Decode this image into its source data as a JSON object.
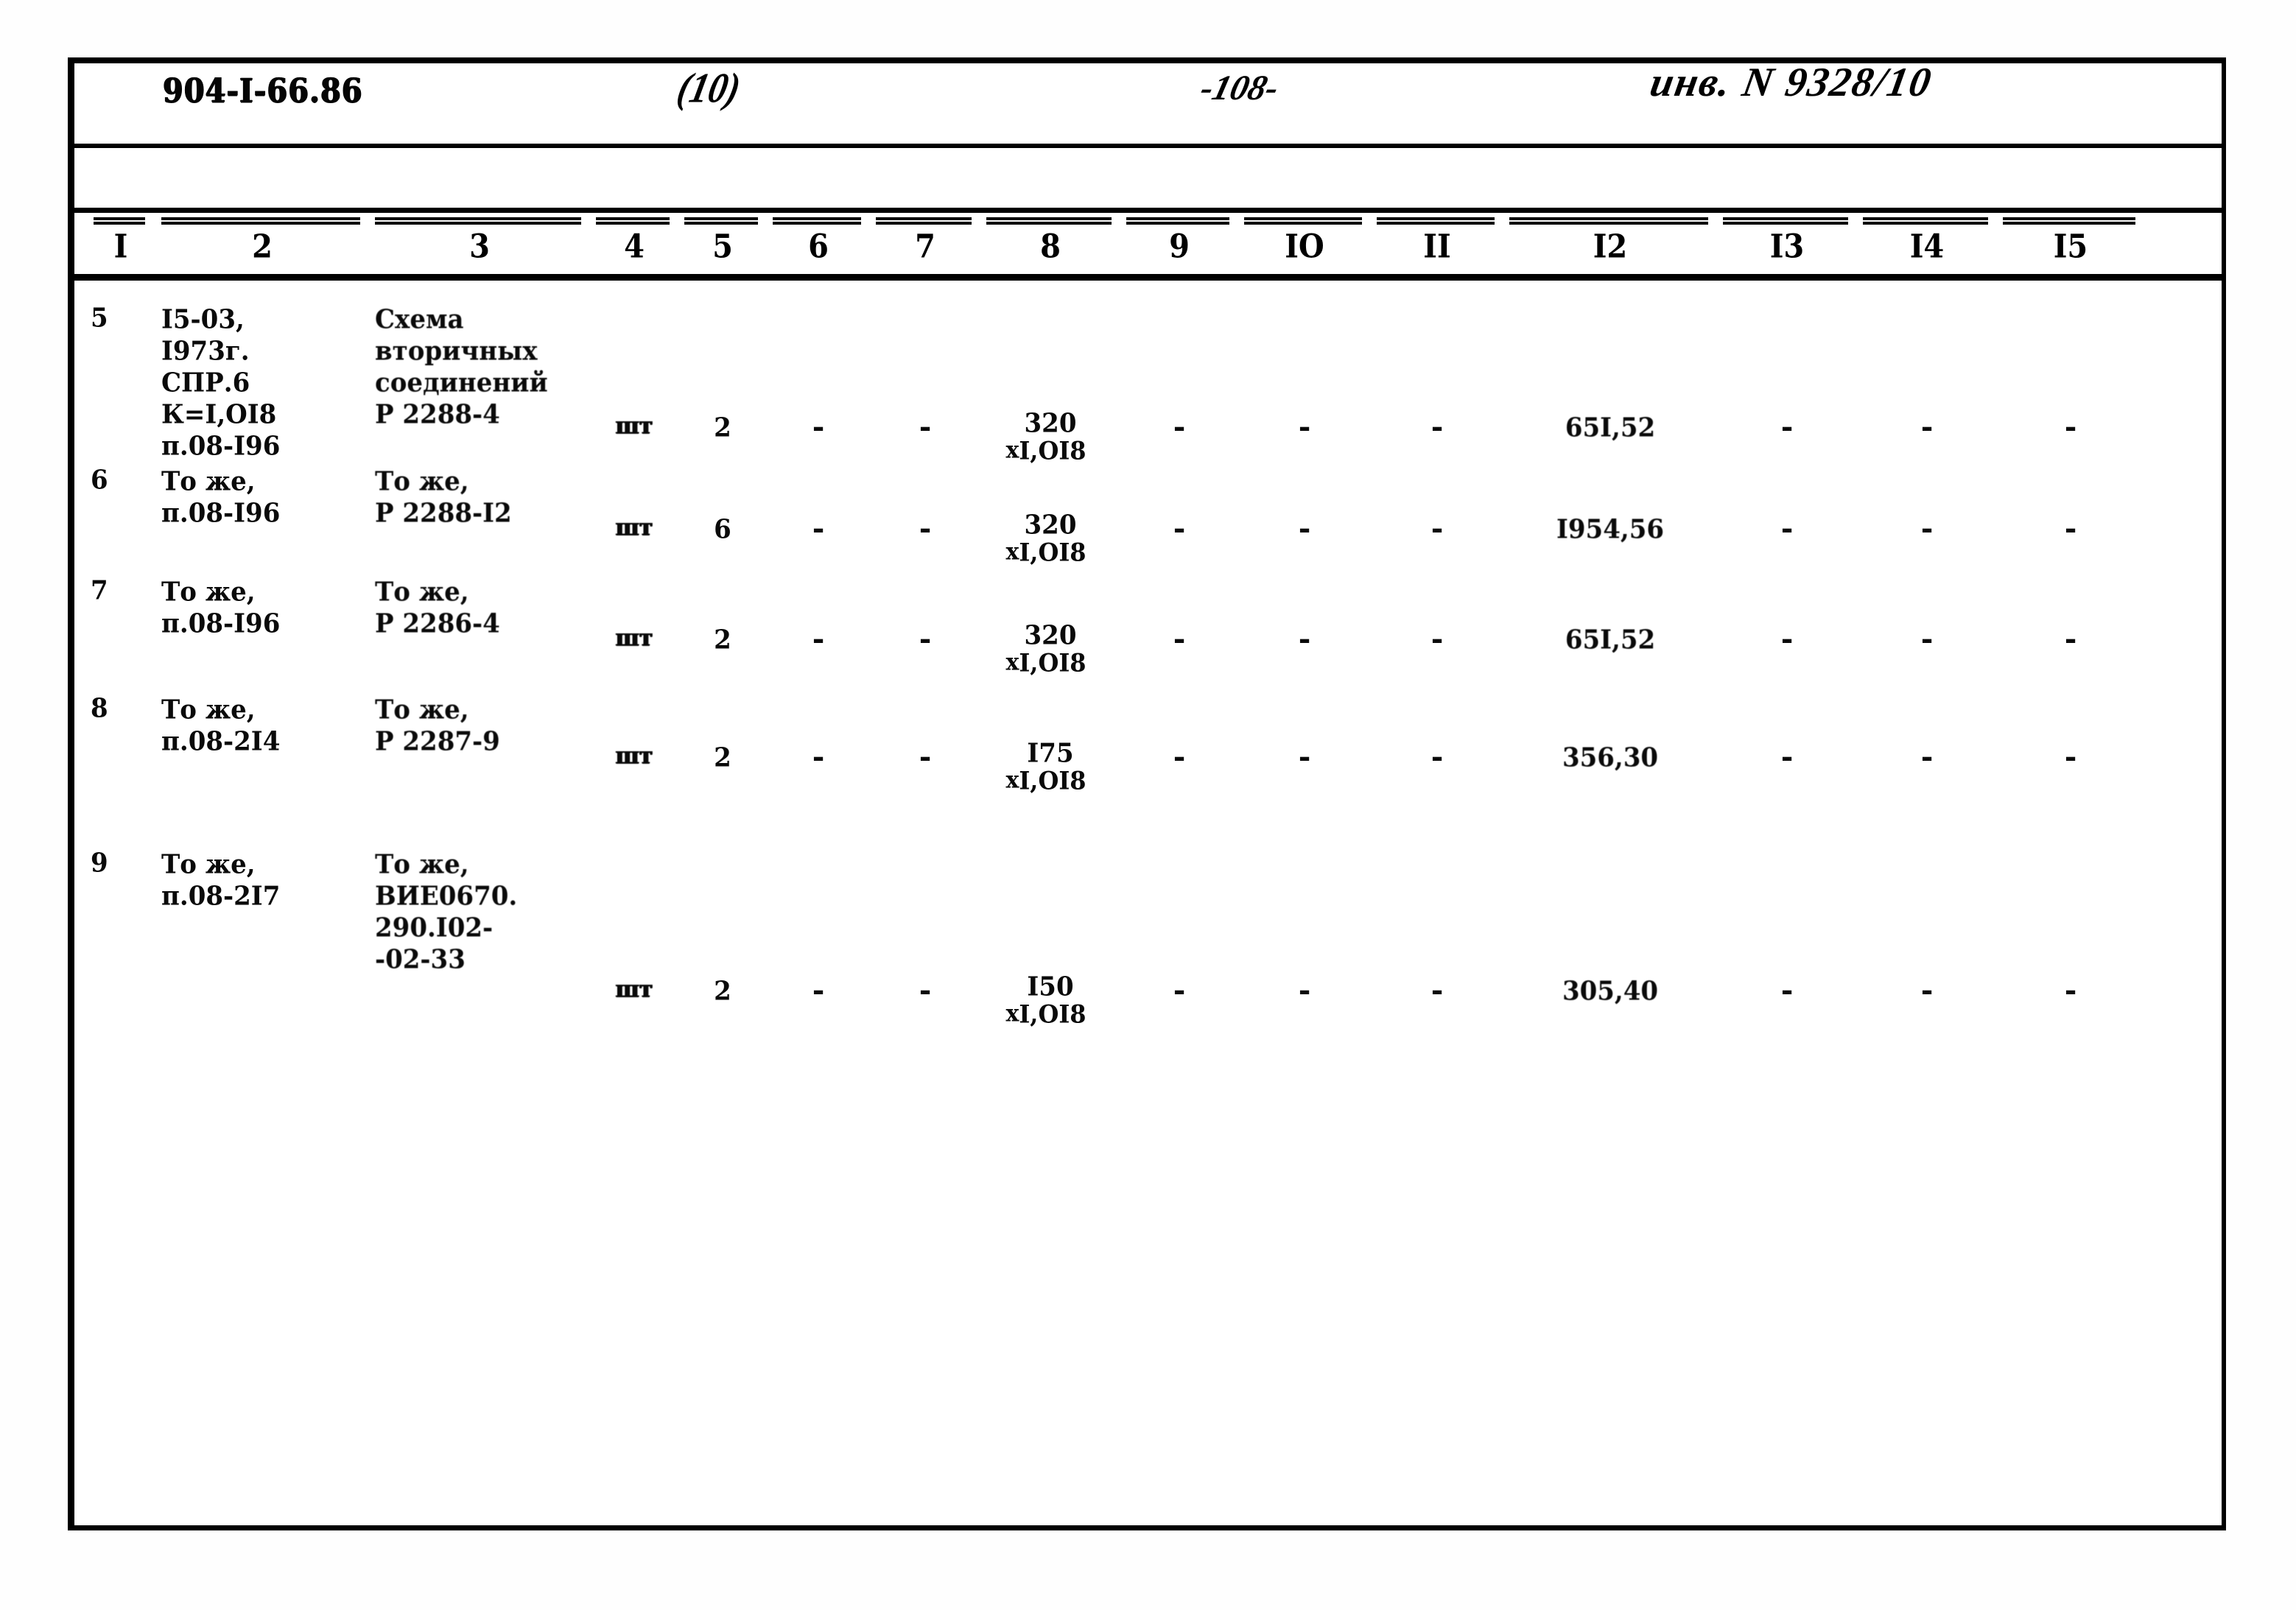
{
  "header": {
    "doc_code": "904-I-66.86",
    "sheet_mark": "(10)",
    "page_number": "-108-",
    "inventory": "инв. N 9328/10"
  },
  "table": {
    "column_headers": [
      "I",
      "2",
      "3",
      "4",
      "5",
      "6",
      "7",
      "8",
      "9",
      "IO",
      "II",
      "I2",
      "I3",
      "I4",
      "I5"
    ],
    "rows": [
      {
        "c1": "5",
        "c2": "I5-03,\nI973г.\nСПР.6\nК=I,OI8\nп.08-I96",
        "c3": "Схема\nвторичных\nсоединений\nР 2288-4",
        "c4": "шт",
        "c5": "2",
        "c6": "-",
        "c7": "-",
        "c8_top": "320",
        "c8_bot": "I,OI8",
        "c9": "-",
        "c10": "-",
        "c11": "-",
        "c12": "65I,52",
        "c13": "-",
        "c14": "-",
        "c15": "-"
      },
      {
        "c1": "6",
        "c2": "То же,\nп.08-I96",
        "c3": "То же,\nР 2288-I2",
        "c4": "шт",
        "c5": "6",
        "c6": "-",
        "c7": "-",
        "c8_top": "320",
        "c8_bot": "I,OI8",
        "c9": "-",
        "c10": "-",
        "c11": "-",
        "c12": "I954,56",
        "c13": "-",
        "c14": "-",
        "c15": "-"
      },
      {
        "c1": "7",
        "c2": "То же,\nп.08-I96",
        "c3": "То же,\nР 2286-4",
        "c4": "шт",
        "c5": "2",
        "c6": "-",
        "c7": "-",
        "c8_top": "320",
        "c8_bot": "I,OI8",
        "c9": "-",
        "c10": "-",
        "c11": "-",
        "c12": "65I,52",
        "c13": "-",
        "c14": "-",
        "c15": "-"
      },
      {
        "c1": "8",
        "c2": "То же,\nп.08-2I4",
        "c3": "То же,\nР 2287-9",
        "c4": "шт",
        "c5": "2",
        "c6": "-",
        "c7": "-",
        "c8_top": "I75",
        "c8_bot": "I,OI8",
        "c9": "-",
        "c10": "-",
        "c11": "-",
        "c12": "356,30",
        "c13": "-",
        "c14": "-",
        "c15": "-"
      },
      {
        "c1": "9",
        "c2": "То же,\nп.08-2I7",
        "c3": "То же,\nВИЕ0670.\n290.I02-\n-02-33",
        "c4": "шт",
        "c5": "2",
        "c6": "-",
        "c7": "-",
        "c8_top": "I50",
        "c8_bot": "I,OI8",
        "c9": "-",
        "c10": "-",
        "c11": "-",
        "c12": "305,40",
        "c13": "-",
        "c14": "-",
        "c15": "-"
      }
    ]
  }
}
